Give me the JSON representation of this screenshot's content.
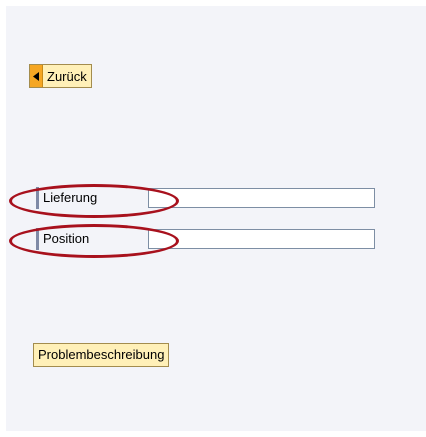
{
  "toolbar": {
    "back_label": "Zurück"
  },
  "form": {
    "fields": [
      {
        "label": "Lieferung",
        "value": ""
      },
      {
        "label": "Position",
        "value": ""
      }
    ]
  },
  "actions": {
    "problem_label": "Problembeschreibung"
  },
  "colors": {
    "button_fill": "#fff0b8",
    "back_icon": "#f5a623",
    "annotation_ellipse": "#a8111d",
    "panel_background": "#f3f4f9"
  }
}
